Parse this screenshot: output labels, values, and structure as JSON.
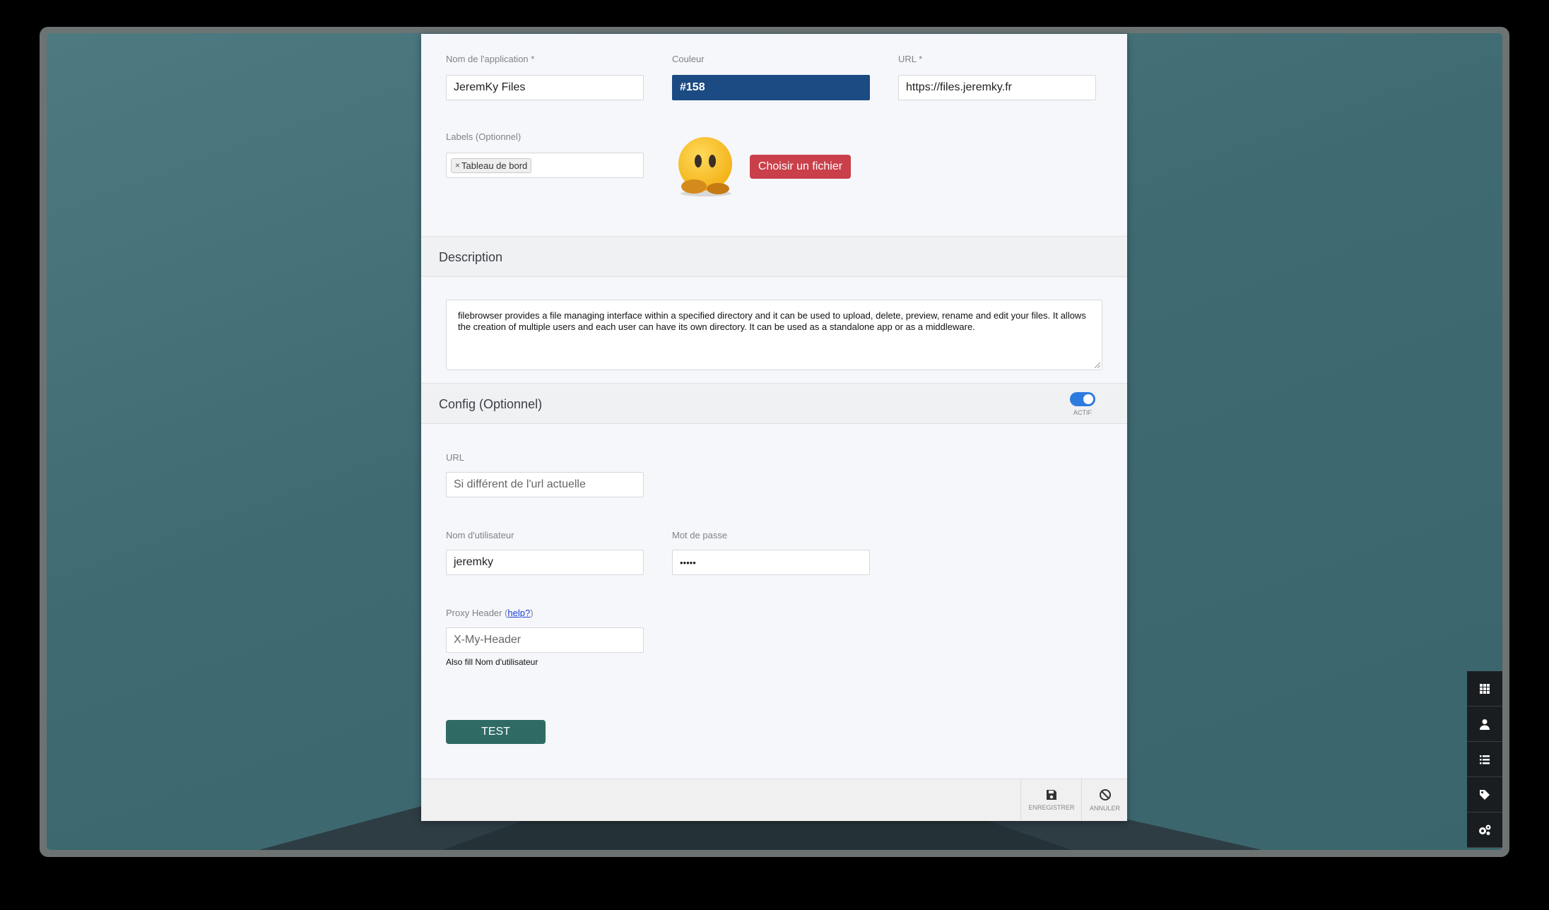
{
  "form": {
    "name_label": "Nom de l'application *",
    "name_value": "JeremKy Files",
    "color_label": "Couleur",
    "color_value": "#158",
    "url_label": "URL *",
    "url_value": "https://files.jeremky.fr",
    "labels_label": "Labels (Optionnel)",
    "labels_tags": [
      "Tableau de bord"
    ],
    "choose_file_button": "Choisir un fichier"
  },
  "description": {
    "title": "Description",
    "text": "filebrowser provides a file managing interface within a specified directory and it can be used to upload, delete, preview, rename and edit your files. It allows the creation of multiple users and each user can have its own directory. It can be used as a standalone app or as a middleware."
  },
  "config": {
    "title": "Config (Optionnel)",
    "toggle_label": "ACTIF",
    "toggle_on": true,
    "url_label": "URL",
    "url_placeholder": "Si différent de l'url actuelle",
    "username_label": "Nom d'utilisateur",
    "username_value": "jeremky",
    "password_label": "Mot de passe",
    "password_value": "•••••",
    "proxy_label_prefix": "Proxy Header (",
    "proxy_help_link": "help?",
    "proxy_label_suffix": ")",
    "proxy_placeholder": "X-My-Header",
    "proxy_hint": "Also fill Nom d'utilisateur",
    "test_button": "TEST"
  },
  "footer": {
    "save_label": "ENREGISTRER",
    "cancel_label": "ANNULER"
  },
  "dock": {
    "icons": [
      "grid-icon",
      "user-icon",
      "list-icon",
      "tag-icon",
      "settings-icon"
    ]
  },
  "colors": {
    "color_field": "#1c4a82",
    "file_button": "#c9404a",
    "test_button": "#2f6b64",
    "toggle": "#2e7be0",
    "dock": "#1a1d20"
  }
}
